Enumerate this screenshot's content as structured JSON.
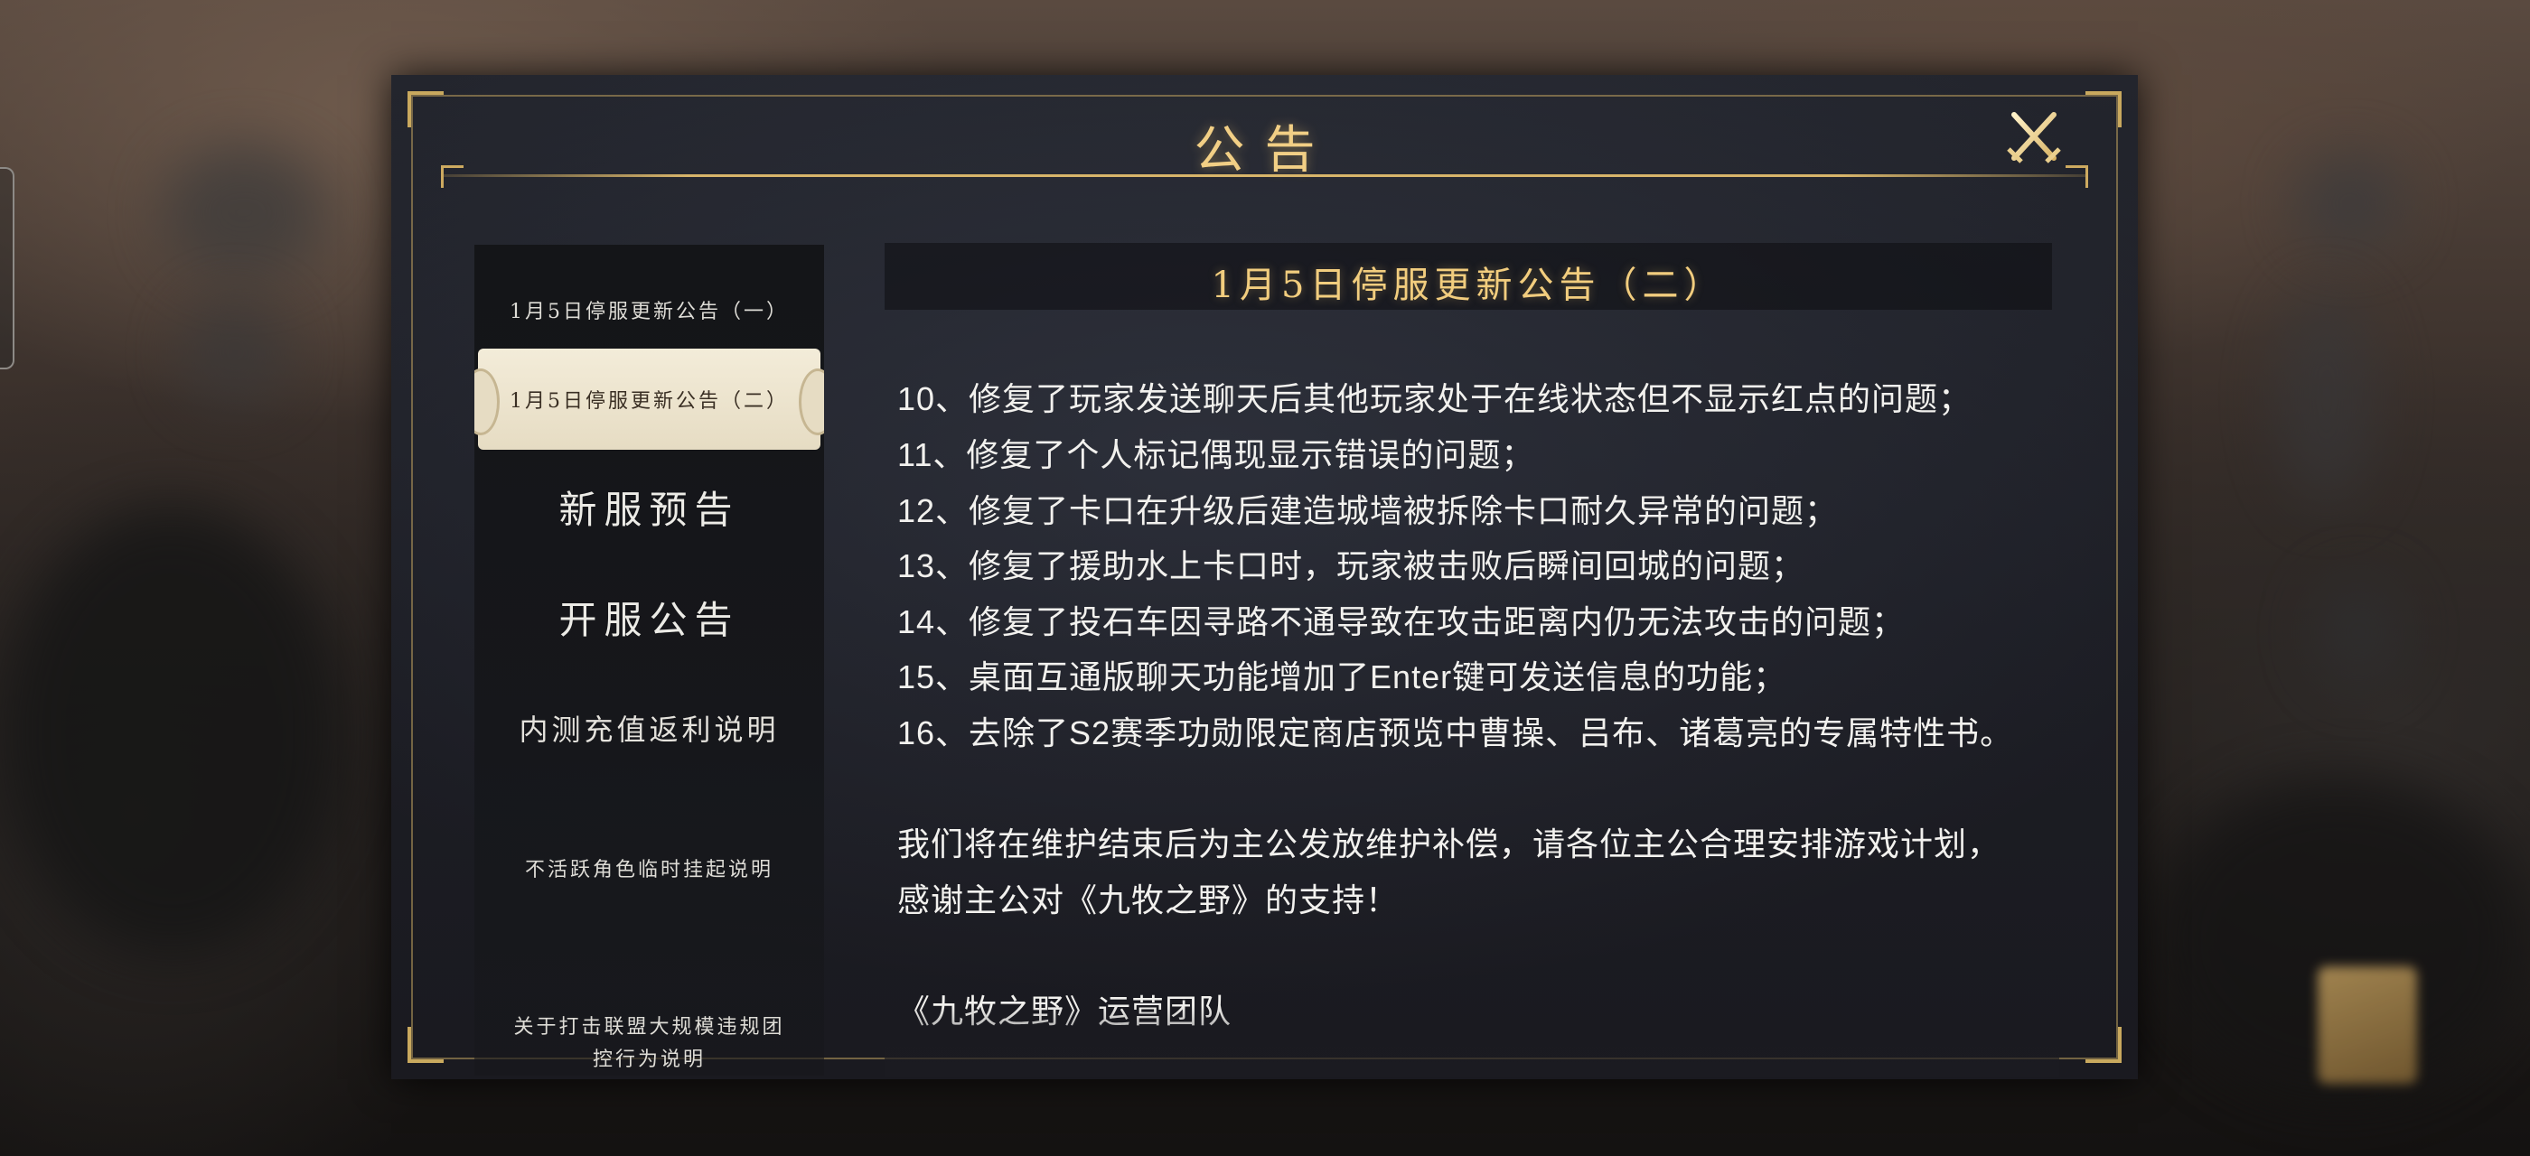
{
  "dialog": {
    "title": "公告",
    "close_icon": "crossed-swords-close-icon"
  },
  "sidebar": {
    "items": [
      {
        "label": "1月5日停服更新公告（一）",
        "active": false
      },
      {
        "label": "1月5日停服更新公告（二）",
        "active": true
      },
      {
        "label": "新服预告",
        "active": false
      },
      {
        "label": "开服公告",
        "active": false
      },
      {
        "label": "内测充值返利说明",
        "active": false
      },
      {
        "label": "不活跃角色临时挂起说明",
        "active": false
      },
      {
        "label": "关于打击联盟大规模违规团",
        "active": false
      },
      {
        "label": "控行为说明",
        "active": false
      }
    ]
  },
  "content": {
    "title": "1月5日停服更新公告（二）",
    "lines": [
      "10、修复了玩家发送聊天后其他玩家处于在线状态但不显示红点的问题；",
      "11、修复了个人标记偶现显示错误的问题；",
      "12、修复了卡口在升级后建造城墙被拆除卡口耐久异常的问题；",
      "13、修复了援助水上卡口时，玩家被击败后瞬间回城的问题；",
      "14、修复了投石车因寻路不通导致在攻击距离内仍无法攻击的问题；",
      "15、桌面互通版聊天功能增加了Enter键可发送信息的功能；",
      "16、去除了S2赛季功勋限定商店预览中曹操、吕布、诸葛亮的专属特性书。",
      "我们将在维护结束后为主公发放维护补偿，请各位主公合理安排游戏计划，",
      "感谢主公对《九牧之野》的支持！",
      "《九牧之野》运营团队"
    ]
  },
  "colors": {
    "gold": "#f2cd7e",
    "panel": "#1c1d24",
    "active_plate": "#f3ecd9"
  }
}
